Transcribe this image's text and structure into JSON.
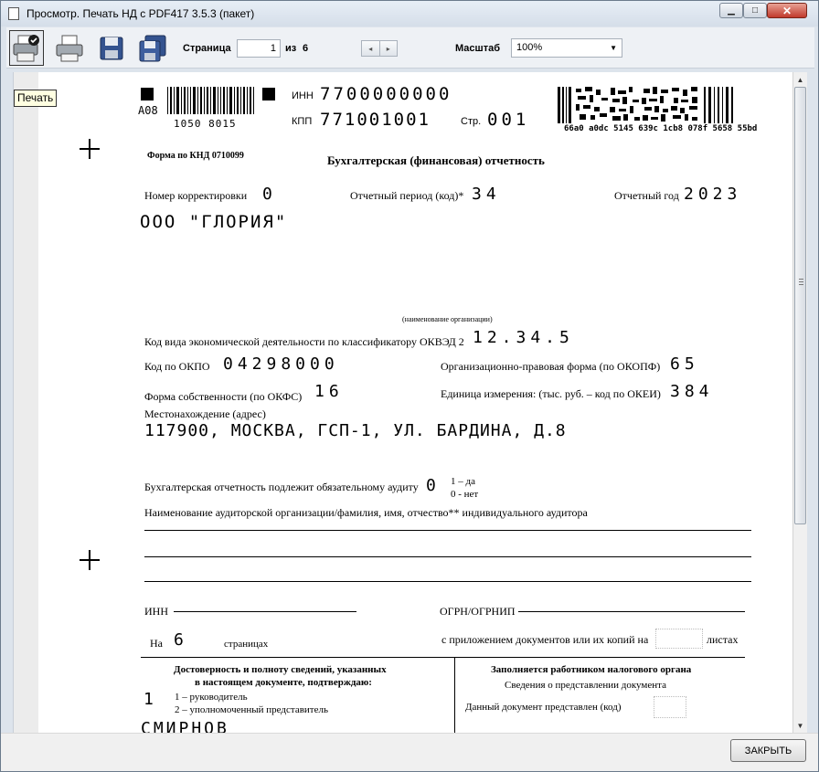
{
  "window": {
    "title": "Просмотр. Печать НД с PDF417 3.5.3 (пакет)",
    "minimize_glyph": "▁",
    "maximize_glyph": "□",
    "close_glyph": "✕"
  },
  "toolbar": {
    "icons": [
      "print-setup-icon",
      "printer-icon",
      "save-disk-icon",
      "save-all-disks-icon"
    ],
    "page_label": "Страница",
    "page_value": "1",
    "of_label": "из",
    "page_total": "6",
    "prev_glyph": "◂",
    "next_glyph": "▸",
    "zoom_label": "Масштаб",
    "zoom_value": "100%",
    "zoom_arrow": "▼"
  },
  "tooltip": "Печать",
  "scrollbar": {
    "up_glyph": "▲",
    "down_glyph": "▼"
  },
  "document": {
    "code_a": "А08",
    "barcode_digits": "1050  8015",
    "inn_label": "ИНН",
    "inn_value": "7700000000",
    "kpp_label": "КПП",
    "kpp_value": "771001001",
    "str_label": "Стр.",
    "str_value": "001",
    "pdf417_hash": "66a0 a0dc 5145 639c 1cb8 078f 5658 55bd",
    "form_label": "Форма по КНД 0710099",
    "heading": "Бухгалтерская (финансовая) отчетность",
    "correction_label": "Номер корректировки",
    "correction_value": "0",
    "period_label": "Отчетный период (код)*",
    "period_value": "34",
    "year_label": "Отчетный год",
    "year_value": "2023",
    "org_name": "ООО \"ГЛОРИЯ\"",
    "org_caption": "(наименование организации)",
    "okved_label": "Код вида экономической деятельности по классификатору ОКВЭД 2",
    "okved_value": "12.34.5",
    "okpo_label": "Код по ОКПО",
    "okpo_value": "04298000",
    "okopf_label": "Организационно-правовая форма (по ОКОПФ)",
    "okopf_value": "65",
    "okfs_label": "Форма собственности (по ОКФС)",
    "okfs_value": "16",
    "okei_label": "Единица измерения: (тыс. руб.  – код по ОКЕИ)",
    "okei_value": "384",
    "address_label": "Местонахождение (адрес)",
    "address_value": "117900, МОСКВА, ГСП-1, УЛ. БАРДИНА, Д.8",
    "audit_label": "Бухгалтерская отчетность подлежит обязательному аудиту",
    "audit_value": "0",
    "audit_yes": "1 – да",
    "audit_no": "0 - нет",
    "auditor_label": "Наименование аудиторской организации/фамилия, имя, отчество** индивидуального аудитора",
    "inn2_label": "ИНН",
    "ogrn_label": "ОГРН/ОГРНИП",
    "on_label": "На",
    "pages_value": "6",
    "pages_label": "страницах",
    "attach_label": "с приложением документов или их копий на",
    "sheets_label": "листах",
    "confirm_line1": "Достоверность и полноту сведений, указанных",
    "confirm_line2": "в настоящем документе, подтверждаю:",
    "signer_value": "1",
    "signer_opt1": "1 – руководитель",
    "signer_opt2": "2 – уполномоченный представитель",
    "signer_name": "СМИРНОВ",
    "tax_heading": "Заполняется работником налогового органа",
    "tax_sub": "Сведения о представлении документа",
    "tax_doc_label": "Данный документ представлен (код)"
  },
  "footer": {
    "close_label": "ЗАКРЫТЬ"
  }
}
